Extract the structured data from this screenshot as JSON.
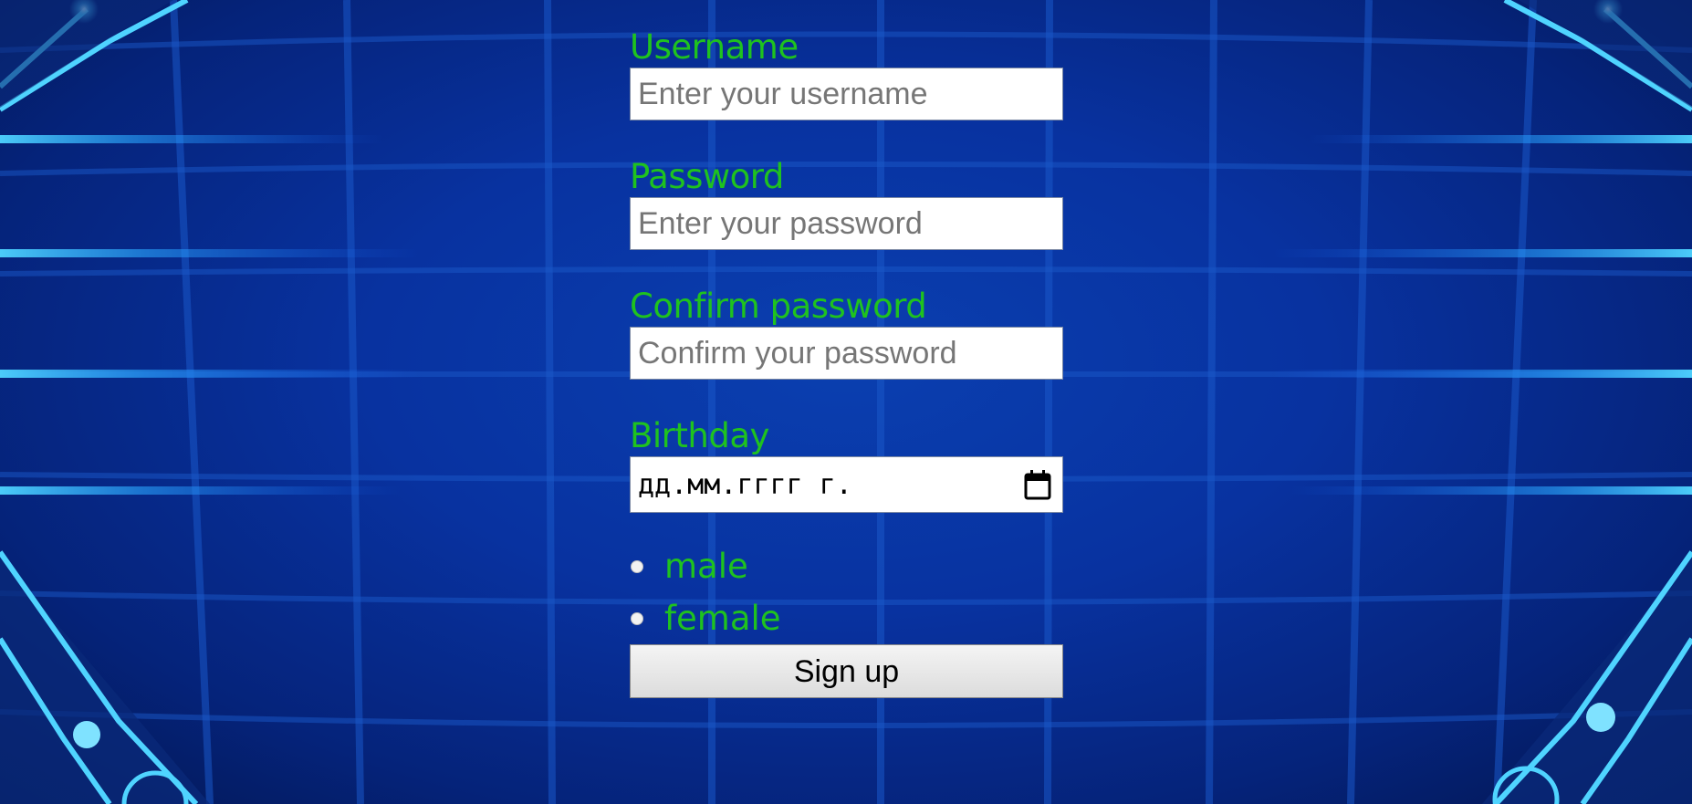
{
  "form": {
    "username": {
      "label": "Username",
      "placeholder": "Enter your username",
      "value": ""
    },
    "password": {
      "label": "Password",
      "placeholder": "Enter your password",
      "value": ""
    },
    "confirm_password": {
      "label": "Confirm password",
      "placeholder": "Confirm your password",
      "value": ""
    },
    "birthday": {
      "label": "Birthday",
      "value_text": "дд.мм.гггг г.",
      "icon": "calendar-icon"
    },
    "gender": {
      "options": [
        {
          "label": "male",
          "checked": false
        },
        {
          "label": "female",
          "checked": false
        }
      ]
    },
    "submit_label": "Sign up"
  },
  "colors": {
    "label_green": "#1fc21f",
    "background_blue": "#0832a0",
    "glow_cyan": "#4fd4ff"
  }
}
